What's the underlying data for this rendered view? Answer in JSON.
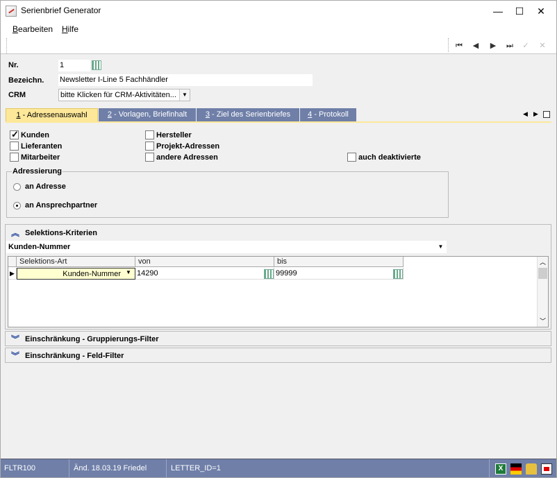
{
  "window": {
    "title": "Serienbrief Generator",
    "minimize": "—",
    "maximize": "☐",
    "close": "✕"
  },
  "menu": {
    "items": [
      {
        "label": "Bearbeiten",
        "accel": "B",
        "rest": "earbeiten"
      },
      {
        "label": "Hilfe",
        "accel": "H",
        "rest": "ilfe"
      }
    ]
  },
  "nav": {
    "first": "⏮",
    "prev": "◀",
    "next": "▶",
    "last": "⏭",
    "confirm": "✓",
    "cancel": "✕"
  },
  "form": {
    "nr_label": "Nr.",
    "nr_value": "1",
    "bez_label": "Bezeichn.",
    "bez_value": "Newsletter I-Line 5 Fachhändler",
    "crm_label": "CRM",
    "crm_value": "bitte Klicken für CRM-Aktivitäten..."
  },
  "tabs": [
    {
      "num": "1",
      "label": " - Adressenauswahl",
      "active": true
    },
    {
      "num": "2",
      "label": " - Vorlagen, Briefinhalt",
      "active": false
    },
    {
      "num": "3",
      "label": " - Ziel des Serienbriefes",
      "active": false
    },
    {
      "num": "4",
      "label": " - Protokoll",
      "active": false
    }
  ],
  "checkboxes": {
    "kunden": {
      "label": "Kunden",
      "checked": true
    },
    "lieferanten": {
      "label": "Lieferanten",
      "checked": false
    },
    "mitarbeiter": {
      "label": "Mitarbeiter",
      "checked": false
    },
    "hersteller": {
      "label": "Hersteller",
      "checked": false
    },
    "projekt": {
      "label": "Projekt-Adressen",
      "checked": false
    },
    "andere": {
      "label": "andere Adressen",
      "checked": false
    },
    "deaktiviert": {
      "label": "auch deaktivierte",
      "checked": false
    }
  },
  "adressierung": {
    "title": "Adressierung",
    "options": [
      {
        "label": "an Adresse",
        "selected": false
      },
      {
        "label": "an Ansprechpartner",
        "selected": true
      }
    ]
  },
  "selektion": {
    "title": "Selektions-Kriterien",
    "dropdown_value": "Kunden-Nummer",
    "columns": [
      "Selektions-Art",
      "von",
      "bis"
    ],
    "rows": [
      {
        "art": "Kunden-Nummer",
        "von": "14290",
        "bis": "99999"
      }
    ]
  },
  "collapsed_sections": [
    "Einschränkung - Gruppierungs-Filter",
    "Einschränkung - Feld-Filter"
  ],
  "status": {
    "code": "FLTR100",
    "changed": "Änd. 18.03.19 Friedel",
    "letter": "LETTER_ID=1"
  },
  "colors": {
    "accent": "#6f7fa8",
    "active_tab": "#fde89a",
    "row_selected": "#ffffd0"
  }
}
